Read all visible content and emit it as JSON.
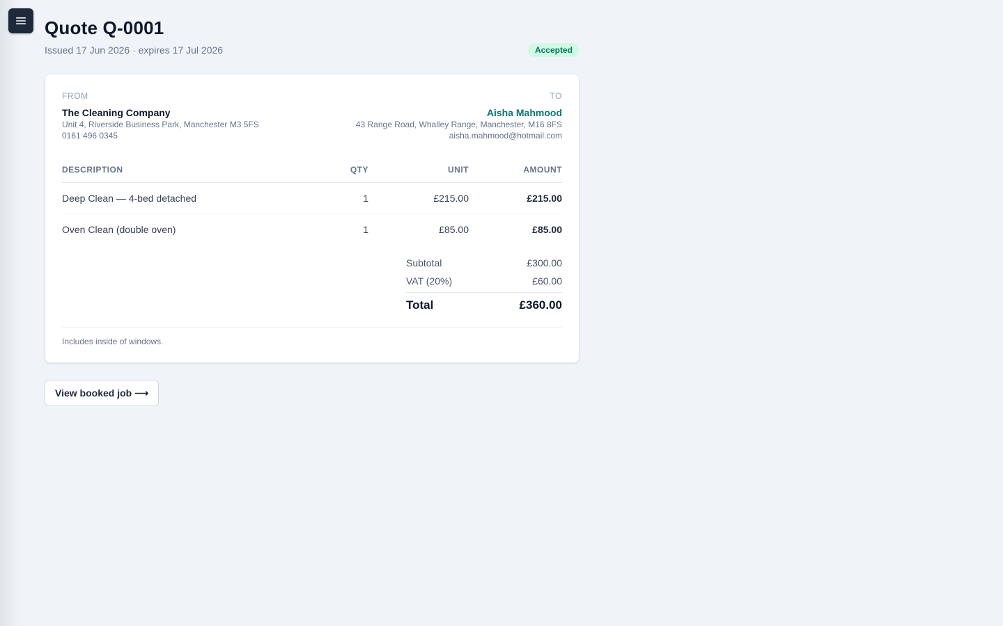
{
  "nav": {
    "menu_icon": "hamburger-icon"
  },
  "quote": {
    "title": "Quote Q-0001",
    "subtitle": "Issued 17 Jun 2026 · expires 17 Jul 2026",
    "status": "Accepted"
  },
  "from": {
    "label": "FROM",
    "name": "The Cleaning Company",
    "address": "Unit 4, Riverside Business Park, Manchester M3 5FS",
    "phone": "0161 496 0345"
  },
  "to": {
    "label": "TO",
    "name": "Aisha Mahmood",
    "address": "43 Range Road, Whalley Range, Manchester, M16 8FS",
    "email": "aisha.mahmood@hotmail.com"
  },
  "table": {
    "headers": {
      "description": "DESCRIPTION",
      "qty": "QTY",
      "unit": "UNIT",
      "amount": "AMOUNT"
    },
    "rows": [
      {
        "description": "Deep Clean — 4-bed detached",
        "qty": "1",
        "unit": "£215.00",
        "amount": "£215.00"
      },
      {
        "description": "Oven Clean (double oven)",
        "qty": "1",
        "unit": "£85.00",
        "amount": "£85.00"
      }
    ]
  },
  "totals": {
    "subtotal_label": "Subtotal",
    "subtotal": "£300.00",
    "vat_label": "VAT (20%)",
    "vat": "£60.00",
    "total_label": "Total",
    "total": "£360.00"
  },
  "notes": "Includes inside of windows.",
  "actions": {
    "view_job": "View booked job",
    "view_job_arrow": "⟶"
  },
  "colors": {
    "accent": "#0f766e",
    "status_bg": "#d1fae5",
    "status_fg": "#047857",
    "nav_button": "#1e293b"
  }
}
